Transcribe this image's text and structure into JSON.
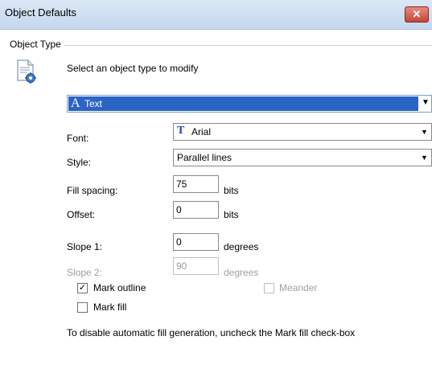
{
  "window": {
    "title": "Object Defaults",
    "close_glyph": "✕"
  },
  "group": {
    "label": "Object Type",
    "instruction": "Select an object type to modify"
  },
  "object_type": {
    "value": "Text",
    "icon_glyph": "A",
    "arrow": "▼"
  },
  "font": {
    "label": "Font:",
    "value": "Arial",
    "icon_glyph": "T",
    "arrow": "▼"
  },
  "style": {
    "label": "Style:",
    "value": "Parallel lines",
    "arrow": "▼"
  },
  "fill_spacing": {
    "label": "Fill spacing:",
    "value": "75",
    "unit": "bits"
  },
  "offset": {
    "label": "Offset:",
    "value": "0",
    "unit": "bits"
  },
  "slope1": {
    "label": "Slope 1:",
    "value": "0",
    "unit": "degrees"
  },
  "slope2": {
    "label": "Slope 2:",
    "value": "90",
    "unit": "degrees"
  },
  "mark_outline": {
    "label": "Mark outline",
    "checked": true,
    "check_glyph": "✓"
  },
  "meander": {
    "label": "Meander",
    "checked": false
  },
  "mark_fill": {
    "label": "Mark fill",
    "checked": false
  },
  "footnote": "To disable automatic fill generation, uncheck the Mark fill check-box"
}
